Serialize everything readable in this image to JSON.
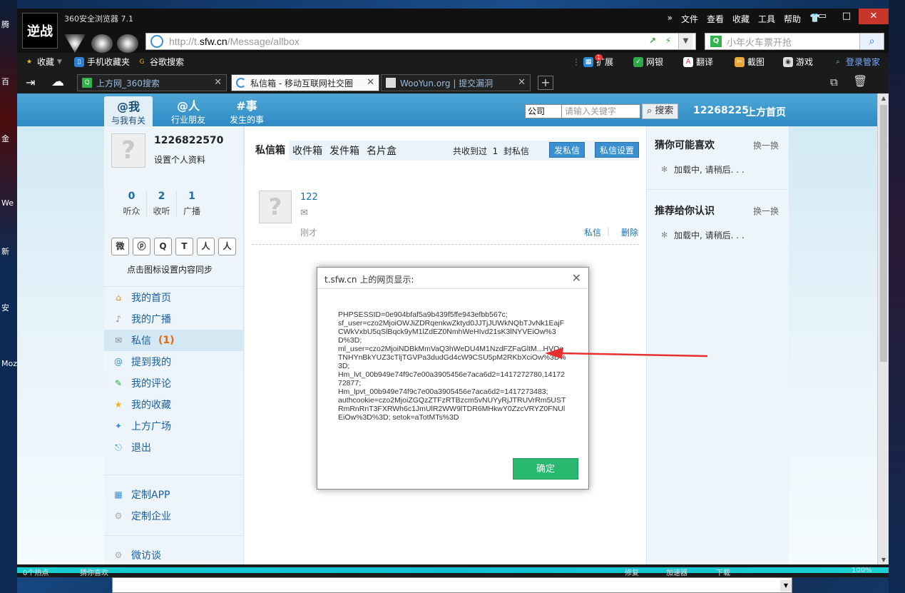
{
  "desktop": {
    "icons": [
      "腾",
      "百",
      "金",
      "We",
      "新",
      "安",
      "Moz"
    ]
  },
  "browser": {
    "logo_text": "逆战",
    "app_title": "360安全浏览器 7.1",
    "menu": [
      "文件",
      "查看",
      "收藏",
      "工具",
      "帮助"
    ],
    "menu_more": "»",
    "win_controls": [
      "▭",
      "□",
      "✕"
    ],
    "address": {
      "prefix": "http://t.",
      "domain": "sfw.cn",
      "path": "/Message/allbox"
    },
    "search_placeholder": "小年火车票开抢",
    "favorites": [
      {
        "label": "收藏",
        "icon": "star-icon",
        "color": "#f2c01e"
      },
      {
        "label": "手机收藏夹",
        "icon": "phone-icon",
        "color": "#2a7fd6"
      },
      {
        "label": "谷歌搜索",
        "icon": "google-icon",
        "color": "#e8a51c"
      }
    ],
    "extensions": [
      {
        "label": "扩展",
        "icon": "extension-icon",
        "badge": "1"
      },
      {
        "label": "网银",
        "icon": "shield-icon"
      },
      {
        "label": "翻译",
        "icon": "translate-icon"
      },
      {
        "label": "截图",
        "icon": "screenshot-icon"
      },
      {
        "label": "游戏",
        "icon": "game-icon"
      },
      {
        "label": "登录管家",
        "icon": "login-icon"
      }
    ],
    "tabs": [
      {
        "label": "上方网_360搜索",
        "icon": "so-icon"
      },
      {
        "label": "私信箱 - 移动互联网社交圈",
        "icon": "loading-icon"
      },
      {
        "label": "WooYun.org | 提交漏洞",
        "icon": "wooyun-icon"
      }
    ],
    "new_tab": "+"
  },
  "site": {
    "nav": [
      {
        "top": "@我",
        "bottom": "与我有关"
      },
      {
        "top": "@人",
        "bottom": "行业朋友"
      },
      {
        "top": "#事",
        "bottom": "发生的事"
      }
    ],
    "search_select": "公司",
    "search_placeholder": "请输入关键字",
    "search_button": "搜索",
    "user_short": "12268225",
    "home_link": "上方首页"
  },
  "profile": {
    "username": "1226822570",
    "setup_link": "设置个人资料",
    "stats": [
      {
        "num": "0",
        "label": "听众"
      },
      {
        "num": "2",
        "label": "收听"
      },
      {
        "num": "1",
        "label": "广播"
      }
    ],
    "socials": [
      "weibo-icon",
      "binding-icon",
      "qq-icon",
      "tencent-icon",
      "renren-icon",
      "people-icon"
    ],
    "social_glyphs": [
      "微",
      "ⓟ",
      "Q",
      "T",
      "人",
      "人"
    ],
    "sync_text": "点击图标设置内容同步"
  },
  "menu": [
    {
      "label": "我的首页",
      "icon": "home-icon",
      "glyph": "⌂",
      "count": ""
    },
    {
      "label": "我的广播",
      "icon": "microphone-icon",
      "glyph": "♪",
      "count": ""
    },
    {
      "label": "私信",
      "icon": "mail-icon",
      "glyph": "✉",
      "count": "(1)"
    },
    {
      "label": "提到我的",
      "icon": "at-icon",
      "glyph": "@",
      "count": ""
    },
    {
      "label": "我的评论",
      "icon": "comment-icon",
      "glyph": "✎",
      "count": ""
    },
    {
      "label": "我的收藏",
      "icon": "star-icon",
      "glyph": "★",
      "count": ""
    },
    {
      "label": "上方广场",
      "icon": "square-icon",
      "glyph": "✦",
      "count": ""
    },
    {
      "label": "退出",
      "icon": "exit-icon",
      "glyph": "⎋",
      "count": ""
    }
  ],
  "menu2": [
    {
      "label": "定制APP",
      "icon": "apps-icon",
      "glyph": "▦"
    },
    {
      "label": "定制企业",
      "icon": "gear-icon",
      "glyph": "⚙"
    }
  ],
  "menu3": [
    {
      "label": "微访谈",
      "icon": "gear-icon",
      "glyph": "⚙"
    }
  ],
  "mailbox": {
    "tabs": [
      "私信箱",
      "收件箱",
      "发件箱",
      "名片盒"
    ],
    "info_prefix": "共收到过",
    "info_count": "1",
    "info_suffix": "封私信",
    "send_button": "发私信",
    "settings_button": "私信设置",
    "msg_name": "122",
    "msg_time": "刚才",
    "reply": "私信",
    "delete": "删除"
  },
  "right_panel": {
    "guess_title": "猜你可能喜欢",
    "swap": "换一换",
    "loading": "加载中, 请稍后. . .",
    "recommend_title": "推荐给你认识"
  },
  "dialog": {
    "title": "t.sfw.cn 上的网页显示:",
    "close": "✕",
    "lines": [
      "PHPSESSID=0e904bfaf5a9b439f5ffe943efbb567c;",
      "sf_user=czo2MjoiOWJiZDRqenkwZktyd0JJTjJUWkNQbTJvNk1EajFCWkVxbU5qSlBqck9yM1lZdEZ0NmhWeHIvd21sK3lNYVEiOw%3D%3D;",
      "ml_user=czo2MjoiNDBkMmVaQ3hWeDU4M1NzdFZFaGltM...HVOeTNHYnBkYUZ3cTljTGVPa3dudGd4cW9CSU5pM2RKbXciOw%3D%3D;",
      "Hm_lvt_00b949e74f9c7e00a3905456e7aca6d2=1417272780,1417272877;",
      "Hm_lpvt_00b949e74f9c7e00a3905456e7aca6d2=1417273483;",
      "authcookie=czo2MjoiZGQzZTFzRTBzcm5vNUYyRjJTRUVrRm5USTRmRnRnT3FXRWh6c1JmUlR2WW9lTDR6MHkwY0ZzcVRYZ0FNUlEiOw%3D%3D; setok=aTotMTs%3D"
    ],
    "ok_button": "确定"
  },
  "statusbar": {
    "items": [
      "0个热点",
      "猜你喜欢",
      "修复",
      "加速器",
      "下载",
      "100%"
    ]
  }
}
